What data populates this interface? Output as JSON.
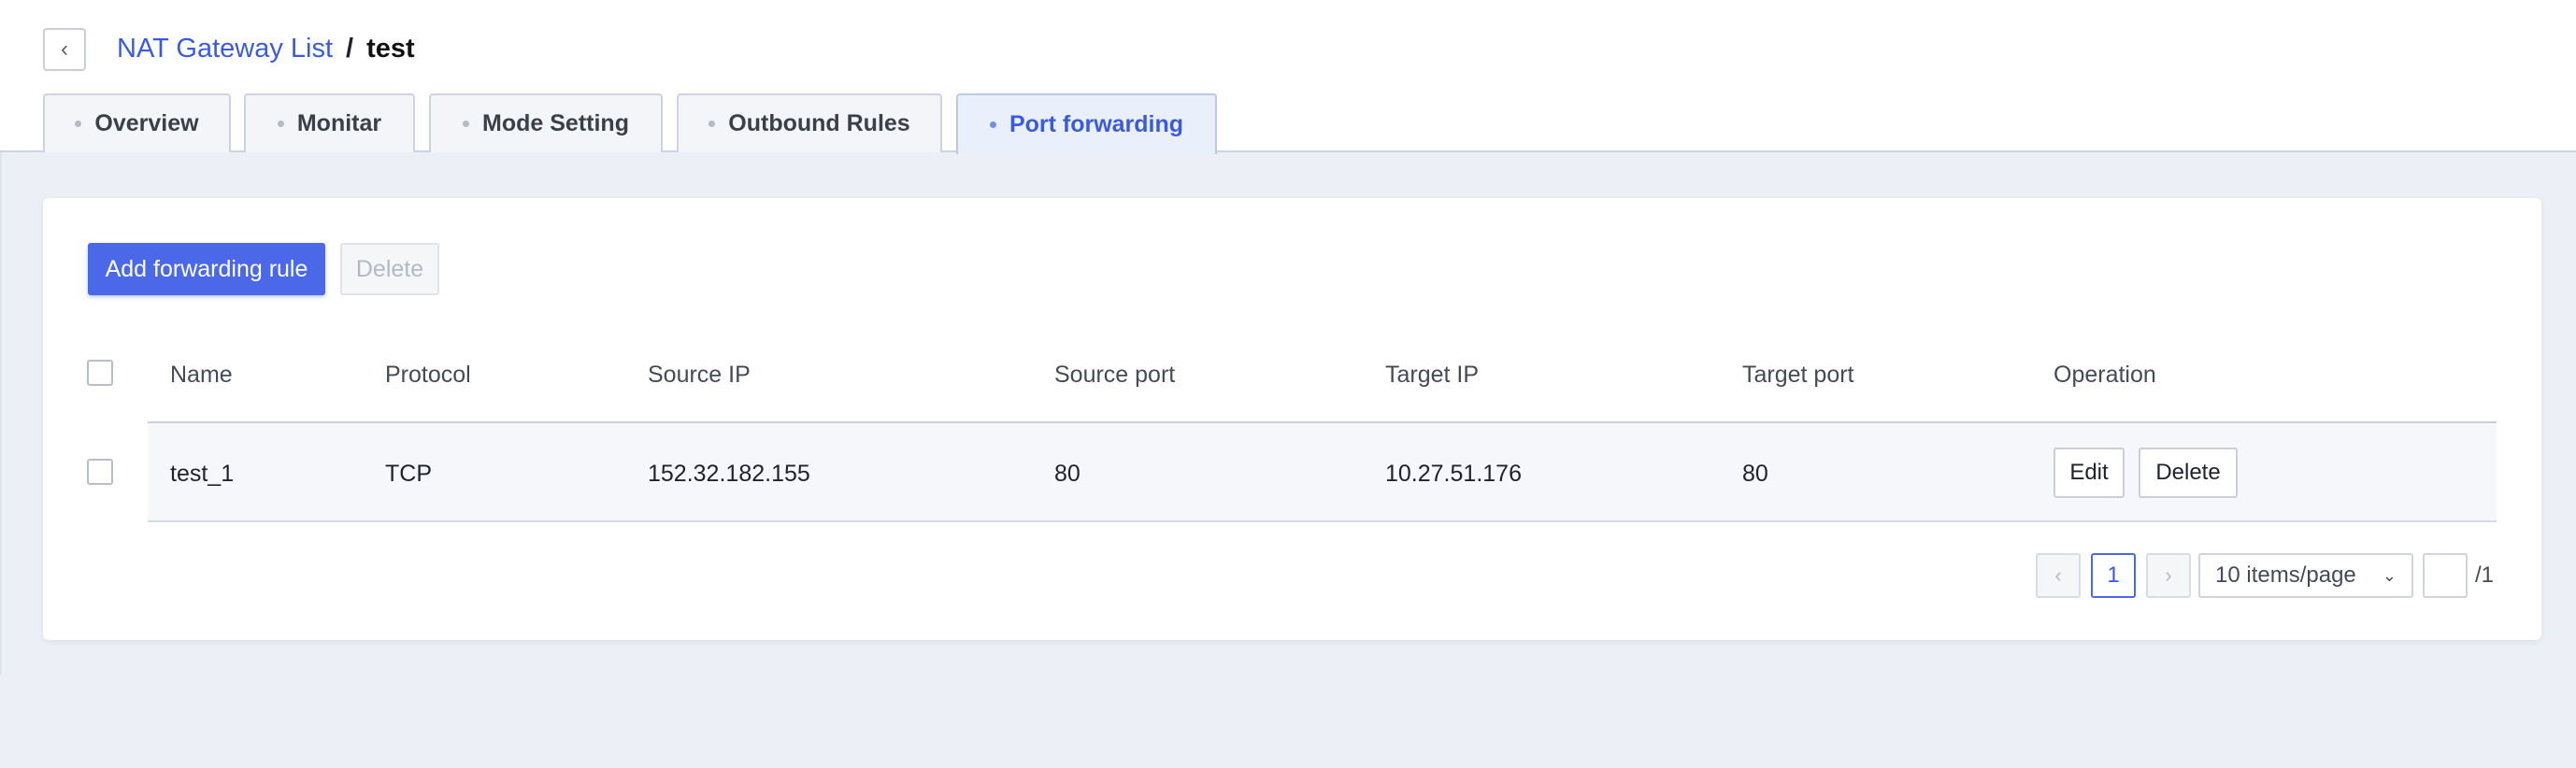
{
  "breadcrumb": {
    "back_icon": "chevron-left-icon",
    "parent": "NAT Gateway List",
    "separator": "/",
    "current": "test"
  },
  "tabs": [
    {
      "label": "Overview",
      "active": false
    },
    {
      "label": "Monitar",
      "active": false
    },
    {
      "label": "Mode Setting",
      "active": false
    },
    {
      "label": "Outbound Rules",
      "active": false
    },
    {
      "label": "Port forwarding",
      "active": true
    }
  ],
  "toolbar": {
    "add_label": "Add forwarding rule",
    "delete_label": "Delete"
  },
  "table": {
    "columns": [
      "Name",
      "Protocol",
      "Source IP",
      "Source port",
      "Target IP",
      "Target port",
      "Operation"
    ],
    "rows": [
      {
        "name": "test_1",
        "protocol": "TCP",
        "source_ip": "152.32.182.155",
        "source_port": "80",
        "target_ip": "10.27.51.176",
        "target_port": "80",
        "edit_label": "Edit",
        "delete_label": "Delete"
      }
    ]
  },
  "pagination": {
    "prev_icon": "chevron-left-icon",
    "current_page": "1",
    "next_icon": "chevron-right-icon",
    "page_size": "10 items/page",
    "total": "/1"
  },
  "colors": {
    "accent": "#4a68e8",
    "link": "#3b5bdb",
    "background": "#eceff6"
  }
}
